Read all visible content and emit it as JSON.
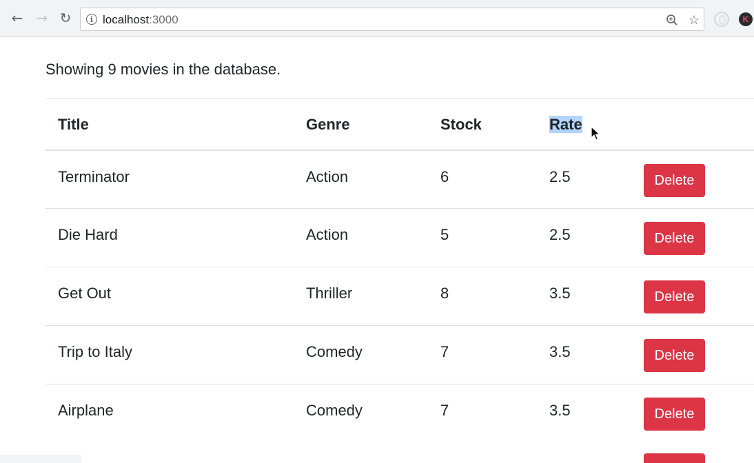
{
  "browser": {
    "url_host": "localhost",
    "url_port": ":3000",
    "profile_initial": "K"
  },
  "page": {
    "summary": "Showing 9 movies in the database."
  },
  "table": {
    "headers": [
      "Title",
      "Genre",
      "Stock",
      "Rate"
    ],
    "rows": [
      {
        "title": "Terminator",
        "genre": "Action",
        "stock": "6",
        "rate": "2.5",
        "action": "Delete"
      },
      {
        "title": "Die Hard",
        "genre": "Action",
        "stock": "5",
        "rate": "2.5",
        "action": "Delete"
      },
      {
        "title": "Get Out",
        "genre": "Thriller",
        "stock": "8",
        "rate": "3.5",
        "action": "Delete"
      },
      {
        "title": "Trip to Italy",
        "genre": "Comedy",
        "stock": "7",
        "rate": "3.5",
        "action": "Delete"
      },
      {
        "title": "Airplane",
        "genre": "Comedy",
        "stock": "7",
        "rate": "3.5",
        "action": "Delete"
      }
    ]
  },
  "colors": {
    "danger": "#dc3545",
    "selection": "#b3d4fd",
    "border": "#dee2e6"
  }
}
